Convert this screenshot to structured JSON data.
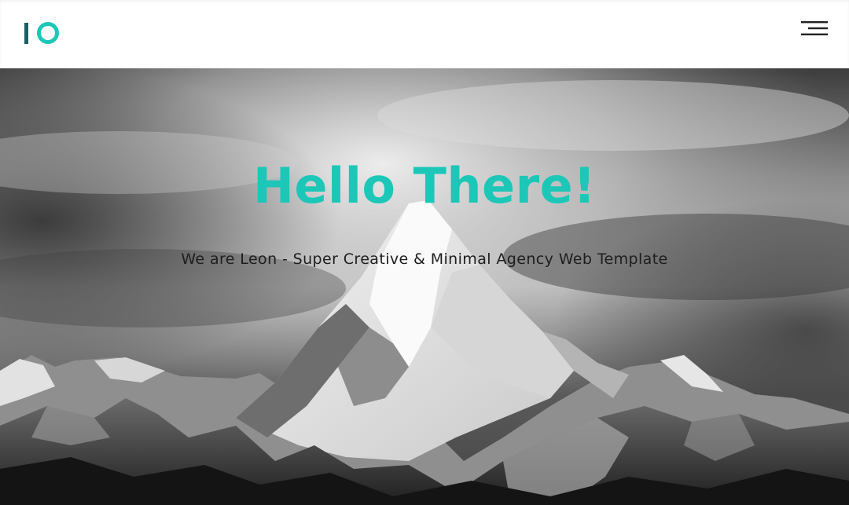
{
  "brand": {
    "logo_text": "IO",
    "accent_color": "#1cc7b8",
    "logo_bar_color": "#1a5f66"
  },
  "header": {
    "menu_icon": "hamburger-menu-icon"
  },
  "hero": {
    "title": "Hello There!",
    "subtitle": "We are Leon - Super Creative & Minimal Agency Web Template",
    "title_color": "#1cc7b8",
    "subtitle_color": "#1e1e1e",
    "background": "black-and-white mountain peak under cloudy sky"
  }
}
